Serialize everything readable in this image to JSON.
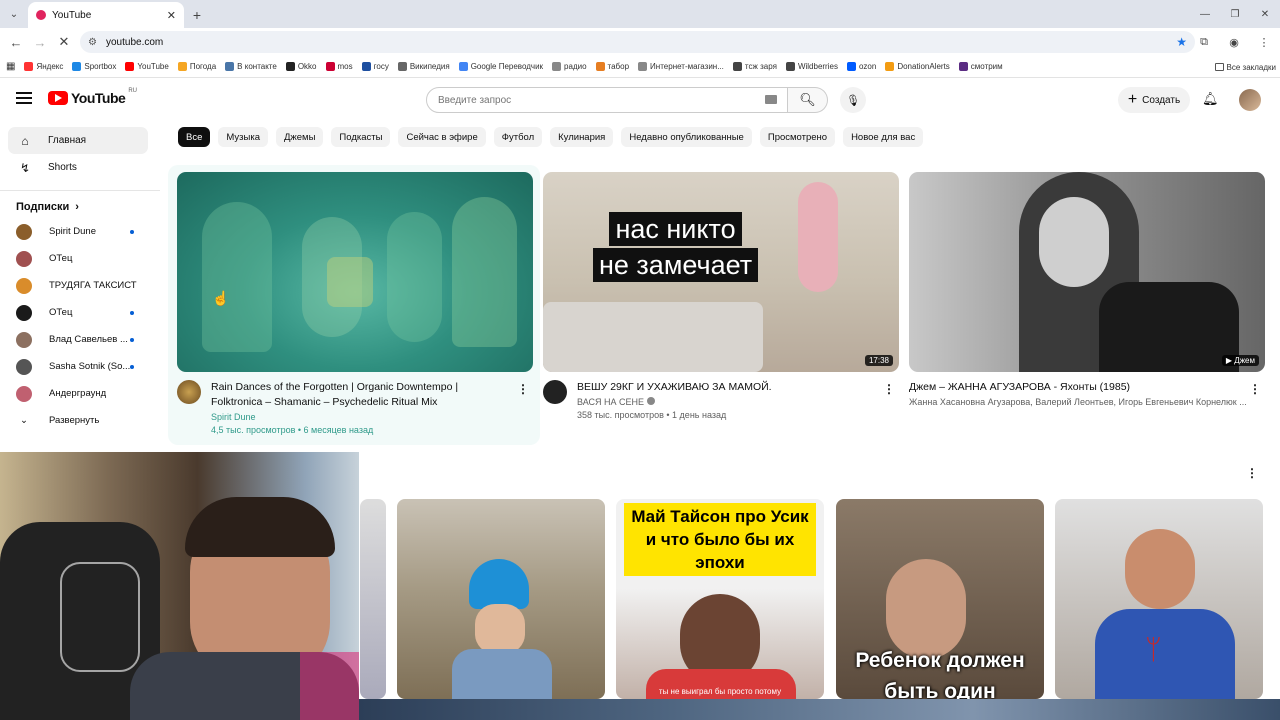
{
  "browser": {
    "tab_title": "YouTube",
    "url": "youtube.com",
    "bookmarks": [
      {
        "label": "Яндекс",
        "color": "#ff3333"
      },
      {
        "label": "Sportbox",
        "color": "#1e88e5"
      },
      {
        "label": "YouTube",
        "color": "#ff0000"
      },
      {
        "label": "Погода",
        "color": "#f5a623"
      },
      {
        "label": "В контакте",
        "color": "#4a76a8"
      },
      {
        "label": "Okko",
        "color": "#222222"
      },
      {
        "label": "mos",
        "color": "#cc0033"
      },
      {
        "label": "госу",
        "color": "#1e4fa0"
      },
      {
        "label": "Википедия",
        "color": "#666666"
      },
      {
        "label": "Google Переводчик",
        "color": "#4285f4"
      },
      {
        "label": "радио",
        "color": "#888888"
      },
      {
        "label": "табор",
        "color": "#e67e22"
      },
      {
        "label": "Интернет-магазин...",
        "color": "#888888"
      },
      {
        "label": "тсж заря",
        "color": "#444444"
      },
      {
        "label": "Wildberries",
        "color": "#444444"
      },
      {
        "label": "ozon",
        "color": "#005bff"
      },
      {
        "label": "DonationAlerts",
        "color": "#f39c12"
      },
      {
        "label": "смотрим",
        "color": "#5b2c83"
      }
    ],
    "all_bookmarks": "Все закладки"
  },
  "header": {
    "logo_text": "YouTube",
    "region": "RU",
    "search_placeholder": "Введите запрос",
    "create_label": "Создать"
  },
  "sidebar": {
    "home": "Главная",
    "shorts": "Shorts",
    "subs_heading": "Подписки",
    "subs": [
      {
        "name": "Spirit Dune",
        "color": "#8b5e2b",
        "dot": true
      },
      {
        "name": "ОТец",
        "color": "#a05050",
        "dot": false
      },
      {
        "name": "ТРУДЯГА ТАКСИСТ",
        "color": "#d98c2b",
        "dot": false
      },
      {
        "name": "ОТец",
        "color": "#1a1a1a",
        "dot": true
      },
      {
        "name": "Влад Савельев ...",
        "color": "#8c7060",
        "dot": true
      },
      {
        "name": "Sasha Sotnik (So...",
        "color": "#555555",
        "dot": true
      },
      {
        "name": "Андерграунд",
        "color": "#c06070",
        "dot": false
      }
    ],
    "expand": "Развернуть"
  },
  "chips": [
    "Все",
    "Музыка",
    "Джемы",
    "Подкасты",
    "Сейчас в эфире",
    "Футбол",
    "Кулинария",
    "Недавно опубликованные",
    "Просмотрено",
    "Новое для вас"
  ],
  "videos": [
    {
      "title": "Rain Dances of the Forgotten | Organic Downtempo | Folktronica – Shamanic – Psychedelic Ritual Mix",
      "channel": "Spirit Dune",
      "stats": "4,5 тыс. просмотров • 6 месяцев назад",
      "duration": ""
    },
    {
      "title": "ВЕШУ 29КГ И УХАЖИВАЮ ЗА МАМОЙ.",
      "channel": "ВАСЯ НА СЕНЕ",
      "stats": "358 тыс. просмотров • 1 день назад",
      "duration": "17:38",
      "overlay_line1": "нас никто",
      "overlay_line2": "не замечает"
    },
    {
      "title": "Джем – ЖАННА АГУЗАРОВА - Яхонты (1985)",
      "channel": "Жанна Хасановна Агузарова, Валерий Леонтьев, Игорь Евгеньевич Корнелюк ...",
      "stats": "",
      "duration": "Джем"
    }
  ],
  "shorts": [
    {
      "text": ""
    },
    {
      "text": ""
    },
    {
      "text": "Май Тайсон про Усик и что было бы их эпохи",
      "subtitle": "ты не выиграл бы просто потому"
    },
    {
      "text": "Ребенок должен быть один"
    },
    {
      "text": ""
    }
  ]
}
